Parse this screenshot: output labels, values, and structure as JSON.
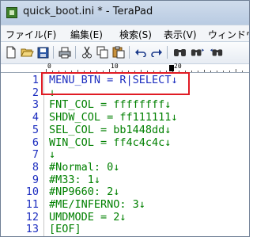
{
  "window": {
    "title": "quick_boot.ini * - TeraPad"
  },
  "menu": [
    {
      "label": "ファイル(F)",
      "left": 0
    },
    {
      "label": "編集(E)"
    },
    {
      "label": "検索(S)"
    },
    {
      "label": "表示(V)"
    },
    {
      "label": "ウィンドウ"
    }
  ],
  "ruler": {
    "marks": [
      "0",
      "10",
      "20"
    ],
    "cursor_column": 18
  },
  "lines": [
    {
      "num": "1",
      "text": "MENU_BTN = R|SELECT↓",
      "has_caret": false
    },
    {
      "num": "2",
      "text": "↓"
    },
    {
      "num": "3",
      "text": "FNT_COL = ffffffff↓"
    },
    {
      "num": "4",
      "text": "SHDW_COL = ff111111↓"
    },
    {
      "num": "5",
      "text": "SEL_COL = bb1448dd↓"
    },
    {
      "num": "6",
      "text": "WIN_COL = ff4c4c4c↓"
    },
    {
      "num": "7",
      "text": "↓"
    },
    {
      "num": "8",
      "text": "#Normal: 0↓"
    },
    {
      "num": "9",
      "text": "#M33: 1↓"
    },
    {
      "num": "10",
      "text": "#NP9660: 2↓"
    },
    {
      "num": "11",
      "text": "#ME/INFERNO: 3↓"
    },
    {
      "num": "12",
      "text": "UMDMODE = 2↓"
    },
    {
      "num": "13",
      "text": "[EOF]"
    }
  ],
  "line1": {
    "before_caret": "MENU_BTN = R",
    "after_caret": "|SELECT↓"
  },
  "icons": [
    "new-file-icon",
    "open-folder-icon",
    "save-icon",
    "print-icon",
    "cut-icon",
    "copy-icon",
    "paste-icon",
    "undo-icon",
    "redo-icon",
    "find-icon",
    "find-next-icon",
    "find-prev-icon"
  ],
  "colors": {
    "code_text": "#008000",
    "line_numbers": "#1b2cbf",
    "highlight_box": "#e01b24"
  }
}
